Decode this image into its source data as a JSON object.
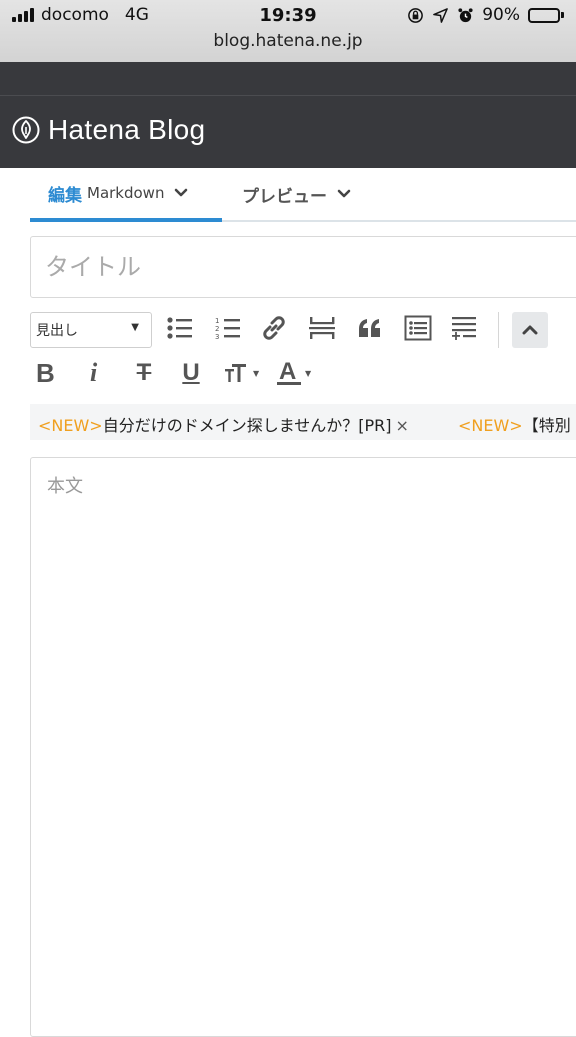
{
  "status_bar": {
    "carrier": "docomo",
    "network": "4G",
    "time": "19:39",
    "battery": "90%",
    "battery_level": 0.9
  },
  "browser": {
    "url": "blog.hatena.ne.jp"
  },
  "app": {
    "logo_text": "Hatena Blog",
    "header_color": "#38393d",
    "accent_color": "#2d8bd2"
  },
  "tabs": [
    {
      "label": "編集",
      "sublabel": "Markdown",
      "active": true
    },
    {
      "label": "プレビュー",
      "active": false
    }
  ],
  "editor": {
    "title_placeholder": "タイトル",
    "body_placeholder": "本文"
  },
  "toolbar": {
    "heading_select": "見出し",
    "buttons": [
      "bullet-list-icon",
      "numbered-list-icon",
      "link-icon",
      "more-break-icon",
      "quote-icon",
      "table-of-contents-icon",
      "footnote-icon",
      "collapse-icon"
    ],
    "format": {
      "bold": "B",
      "italic": "i",
      "strike": "T",
      "underline": "U",
      "size": "T",
      "color": "A"
    }
  },
  "pr_banner": {
    "items": [
      {
        "tag": "<NEW>",
        "text": "自分だけのドメイン探しませんか？[PR]",
        "close": "×"
      },
      {
        "tag": "<NEW>",
        "text": "【特別"
      }
    ],
    "tag_color": "#f0a020"
  }
}
